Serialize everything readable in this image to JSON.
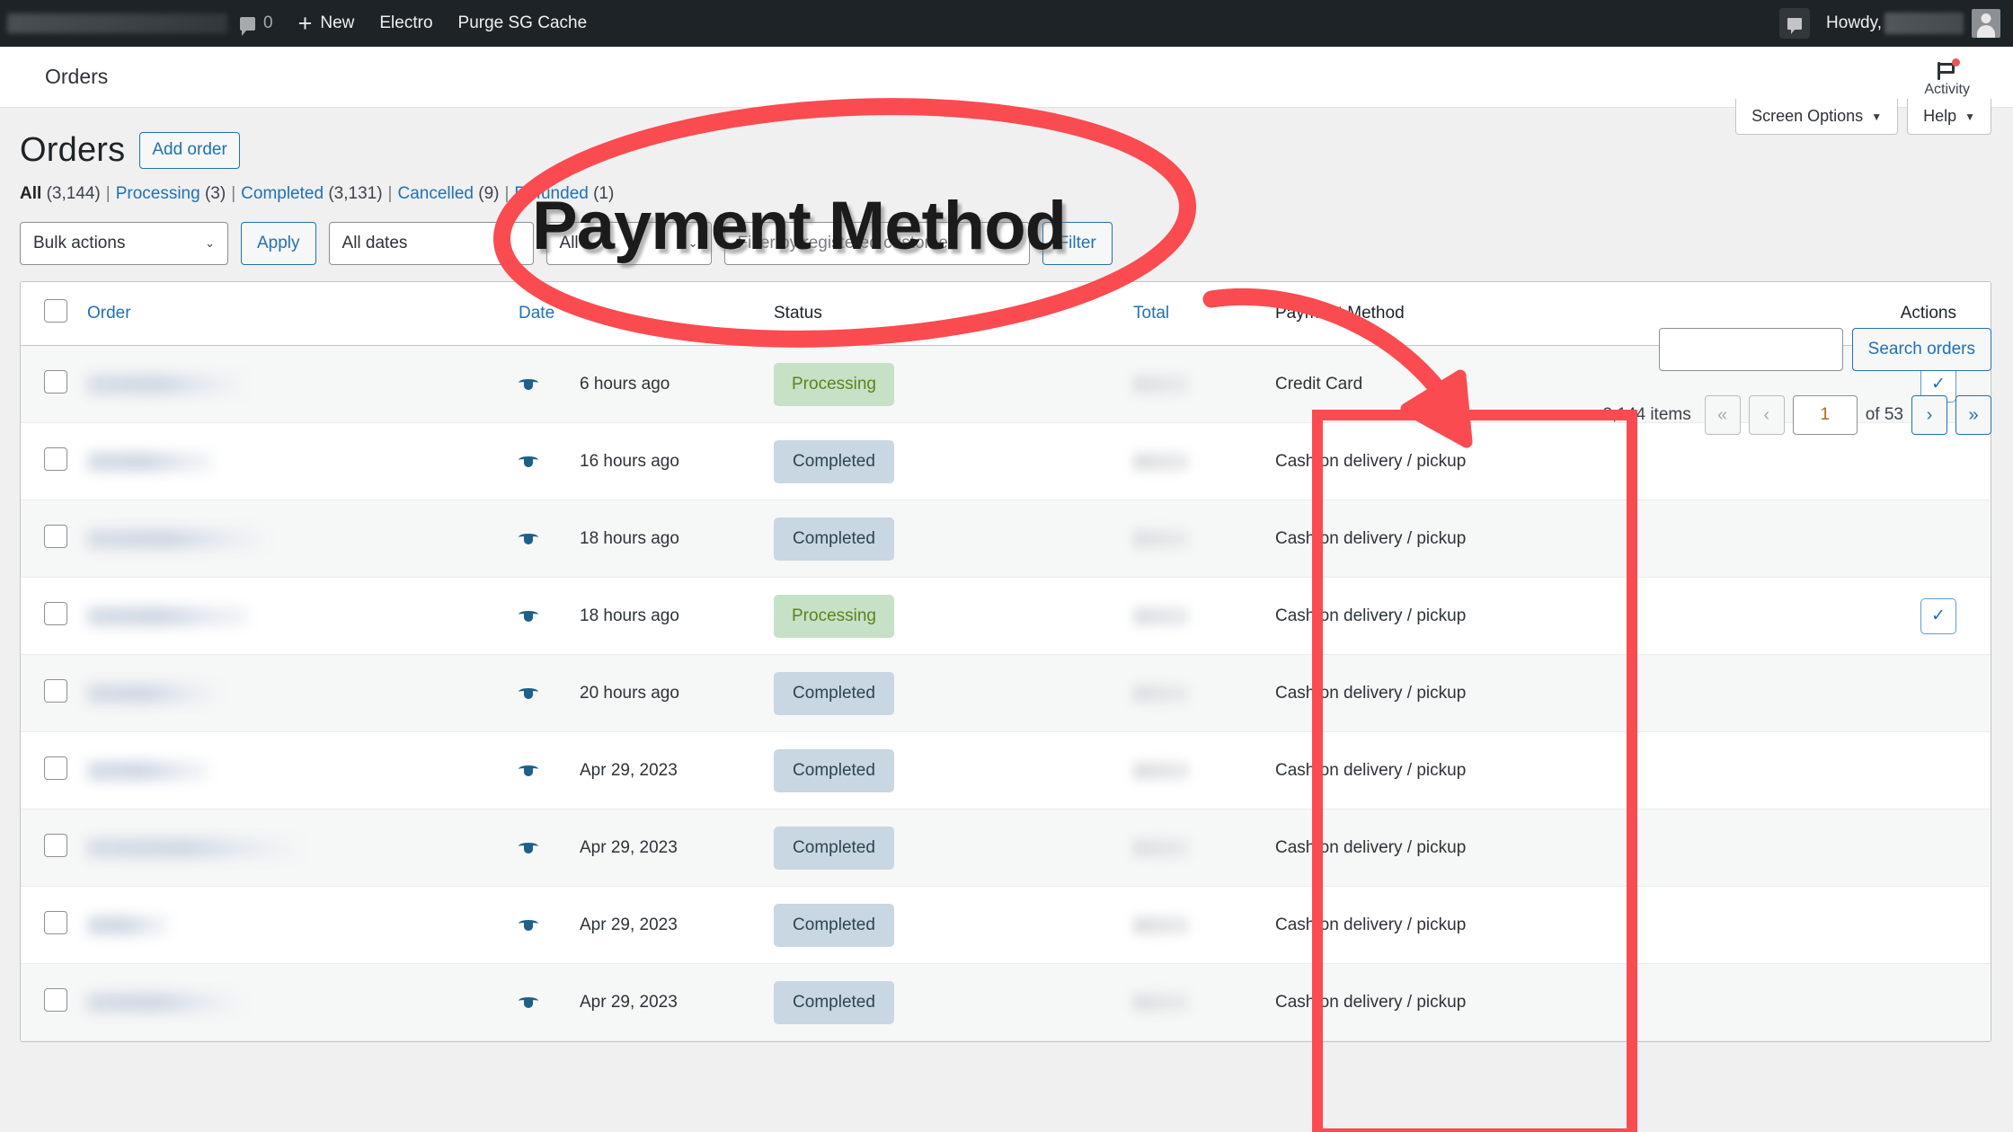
{
  "adminbar": {
    "site_name_redacted": true,
    "comments_icon": "comment-icon",
    "comments_count": "0",
    "new_label": "New",
    "electro_label": "Electro",
    "purge_label": "Purge SG Cache",
    "howdy_label": "Howdy,",
    "user_redacted": true
  },
  "subheader": {
    "title": "Orders",
    "activity_label": "Activity",
    "activity_icon": "flag-icon"
  },
  "screen_meta": {
    "screen_options_label": "Screen Options",
    "help_label": "Help",
    "caret": "▼"
  },
  "page": {
    "title": "Orders",
    "add_order_label": "Add order"
  },
  "status_links": [
    {
      "label": "All",
      "count": "(3,144)",
      "current": true
    },
    {
      "label": "Processing",
      "count": "(3)",
      "current": false
    },
    {
      "label": "Completed",
      "count": "(3,131)",
      "current": false
    },
    {
      "label": "Cancelled",
      "count": "(9)",
      "current": false
    },
    {
      "label": "Refunded",
      "count": "(1)",
      "current": false
    }
  ],
  "toolbar": {
    "bulk_actions_value": "Bulk actions",
    "apply_label": "Apply",
    "all_dates_value": "All dates",
    "all_value": "All",
    "customer_placeholder": "Filter by registered customer",
    "filter_label": "Filter"
  },
  "search": {
    "value": "",
    "button_label": "Search orders"
  },
  "pagination": {
    "items_label": "3,144 items",
    "first_label": "«",
    "prev_label": "‹",
    "current_page": "1",
    "of_label": "of 53",
    "next_label": "›",
    "last_label": "»"
  },
  "table": {
    "columns": [
      {
        "key": "cb",
        "label": ""
      },
      {
        "key": "order",
        "label": "Order",
        "link": true
      },
      {
        "key": "date",
        "label": "Date",
        "link": true
      },
      {
        "key": "status",
        "label": "Status",
        "link": false
      },
      {
        "key": "total",
        "label": "Total",
        "link": true
      },
      {
        "key": "payment",
        "label": "Payment Method",
        "link": false
      },
      {
        "key": "actions",
        "label": "Actions",
        "link": false
      }
    ],
    "rows": [
      {
        "order": "",
        "date": "6 hours ago",
        "status": "Processing",
        "status_type": "processing",
        "total": "",
        "payment": "Credit Card",
        "action": "✓"
      },
      {
        "order": "",
        "date": "16 hours ago",
        "status": "Completed",
        "status_type": "completed",
        "total": "",
        "payment": "Cash on delivery / pickup",
        "action": ""
      },
      {
        "order": "",
        "date": "18 hours ago",
        "status": "Completed",
        "status_type": "completed",
        "total": "",
        "payment": "Cash on delivery / pickup",
        "action": ""
      },
      {
        "order": "",
        "date": "18 hours ago",
        "status": "Processing",
        "status_type": "processing",
        "total": "",
        "payment": "Cash on delivery / pickup",
        "action": "✓"
      },
      {
        "order": "",
        "date": "20 hours ago",
        "status": "Completed",
        "status_type": "completed",
        "total": "",
        "payment": "Cash on delivery / pickup",
        "action": ""
      },
      {
        "order": "",
        "date": "Apr 29, 2023",
        "status": "Completed",
        "status_type": "completed",
        "total": "",
        "payment": "Cash on delivery / pickup",
        "action": ""
      },
      {
        "order": "",
        "date": "Apr 29, 2023",
        "status": "Completed",
        "status_type": "completed",
        "total": "",
        "payment": "Cash on delivery / pickup",
        "action": ""
      },
      {
        "order": "",
        "date": "Apr 29, 2023",
        "status": "Completed",
        "status_type": "completed",
        "total": "",
        "payment": "Cash on delivery / pickup",
        "action": ""
      },
      {
        "order": "",
        "date": "Apr 29, 2023",
        "status": "Completed",
        "status_type": "completed",
        "total": "",
        "payment": "Cash on delivery / pickup",
        "action": ""
      }
    ]
  },
  "annotations": {
    "callout_text": "Payment Method",
    "accent_color": "#fa4b50",
    "ellipse_note": "red hand-drawn ellipse around callout text",
    "arrow_note": "red curved arrow pointing to Payment Method column",
    "box_note": "red rectangle highlighting Payment Method column cells"
  }
}
